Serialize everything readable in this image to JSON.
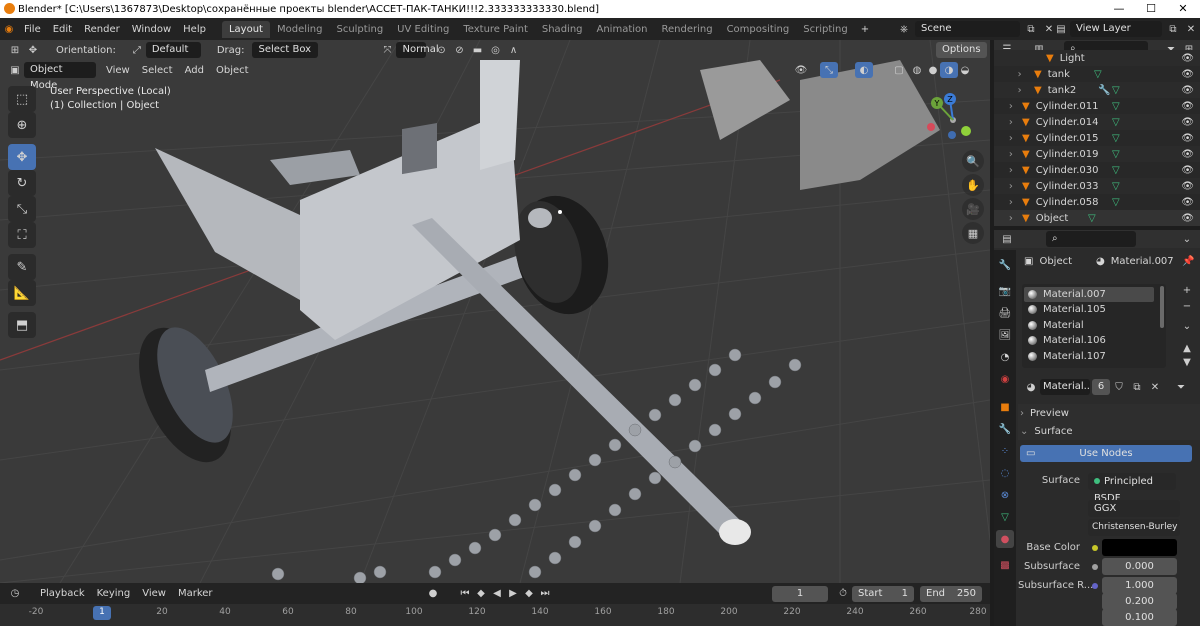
{
  "window": {
    "title": "Blender* [C:\\Users\\1367873\\Desktop\\сохранённые проекты blender\\АССЕТ-ПАК-ТАНКИ!!!2.333333333330.blend]",
    "minimize": "—",
    "maximize": "☐",
    "close": "✕"
  },
  "menu": [
    "File",
    "Edit",
    "Render",
    "Window",
    "Help"
  ],
  "workspaces": [
    "Layout",
    "Modeling",
    "Sculpting",
    "UV Editing",
    "Texture Paint",
    "Shading",
    "Animation",
    "Rendering",
    "Compositing",
    "Scripting"
  ],
  "workspace_add": "+",
  "scene": {
    "label": "Scene",
    "view_layer": "View Layer"
  },
  "viewport_header": {
    "orientation_label": "Orientation:",
    "orientation_value": "Default",
    "drag_label": "Drag:",
    "drag_value": "Select Box",
    "pivot_value": "Normal",
    "options_label": "Options",
    "mode": "Object Mode",
    "menus": [
      "View",
      "Select",
      "Add",
      "Object"
    ]
  },
  "viewport_info": {
    "perspective": "User Perspective (Local)",
    "collection": "(1) Collection | Object"
  },
  "gizmo": {
    "x": "X",
    "y": "Y",
    "z": "Z"
  },
  "outliner": {
    "items": [
      {
        "name": "Light",
        "indent": 2
      },
      {
        "name": "tank",
        "indent": 2
      },
      {
        "name": "tank2",
        "indent": 2
      },
      {
        "name": "Cylinder.011",
        "indent": 1
      },
      {
        "name": "Cylinder.014",
        "indent": 1
      },
      {
        "name": "Cylinder.015",
        "indent": 1
      },
      {
        "name": "Cylinder.019",
        "indent": 1
      },
      {
        "name": "Cylinder.030",
        "indent": 1
      },
      {
        "name": "Cylinder.033",
        "indent": 1
      },
      {
        "name": "Cylinder.058",
        "indent": 1
      },
      {
        "name": "Object",
        "indent": 1
      }
    ]
  },
  "properties": {
    "breadcrumb_object": "Object",
    "breadcrumb_material": "Material.007",
    "material_slots": [
      "Material.007",
      "Material.105",
      "Material",
      "Material.106",
      "Material.107"
    ],
    "active_material": "Material...",
    "user_count": "6",
    "preview_label": "Preview",
    "surface_label": "Surface",
    "use_nodes": "Use Nodes",
    "surface_field_label": "Surface",
    "surface_value": "Principled BSDF",
    "distribution": "GGX",
    "subsurface_method": "Christensen-Burley",
    "base_color_label": "Base Color",
    "base_color": "#000000",
    "subsurface_label": "Subsurface",
    "subsurface_value": "0.000",
    "subsurface_radius_label": "Subsurface R...",
    "subsurface_radius": [
      "1.000",
      "0.200",
      "0.100"
    ]
  },
  "timeline": {
    "menus": [
      "Playback",
      "Keying",
      "View",
      "Marker"
    ],
    "current_frame": "1",
    "start_label": "Start",
    "start_value": "1",
    "end_label": "End",
    "end_value": "250",
    "ruler": [
      "-20",
      "1",
      "20",
      "40",
      "60",
      "80",
      "100",
      "120",
      "140",
      "160",
      "180",
      "200",
      "220",
      "240",
      "260",
      "280"
    ]
  },
  "colors": {
    "accent": "#4772b3",
    "viewport_bg": "#3a3a3a",
    "object_orange": "#e87d0d",
    "mesh_green": "#3fbf7f"
  }
}
